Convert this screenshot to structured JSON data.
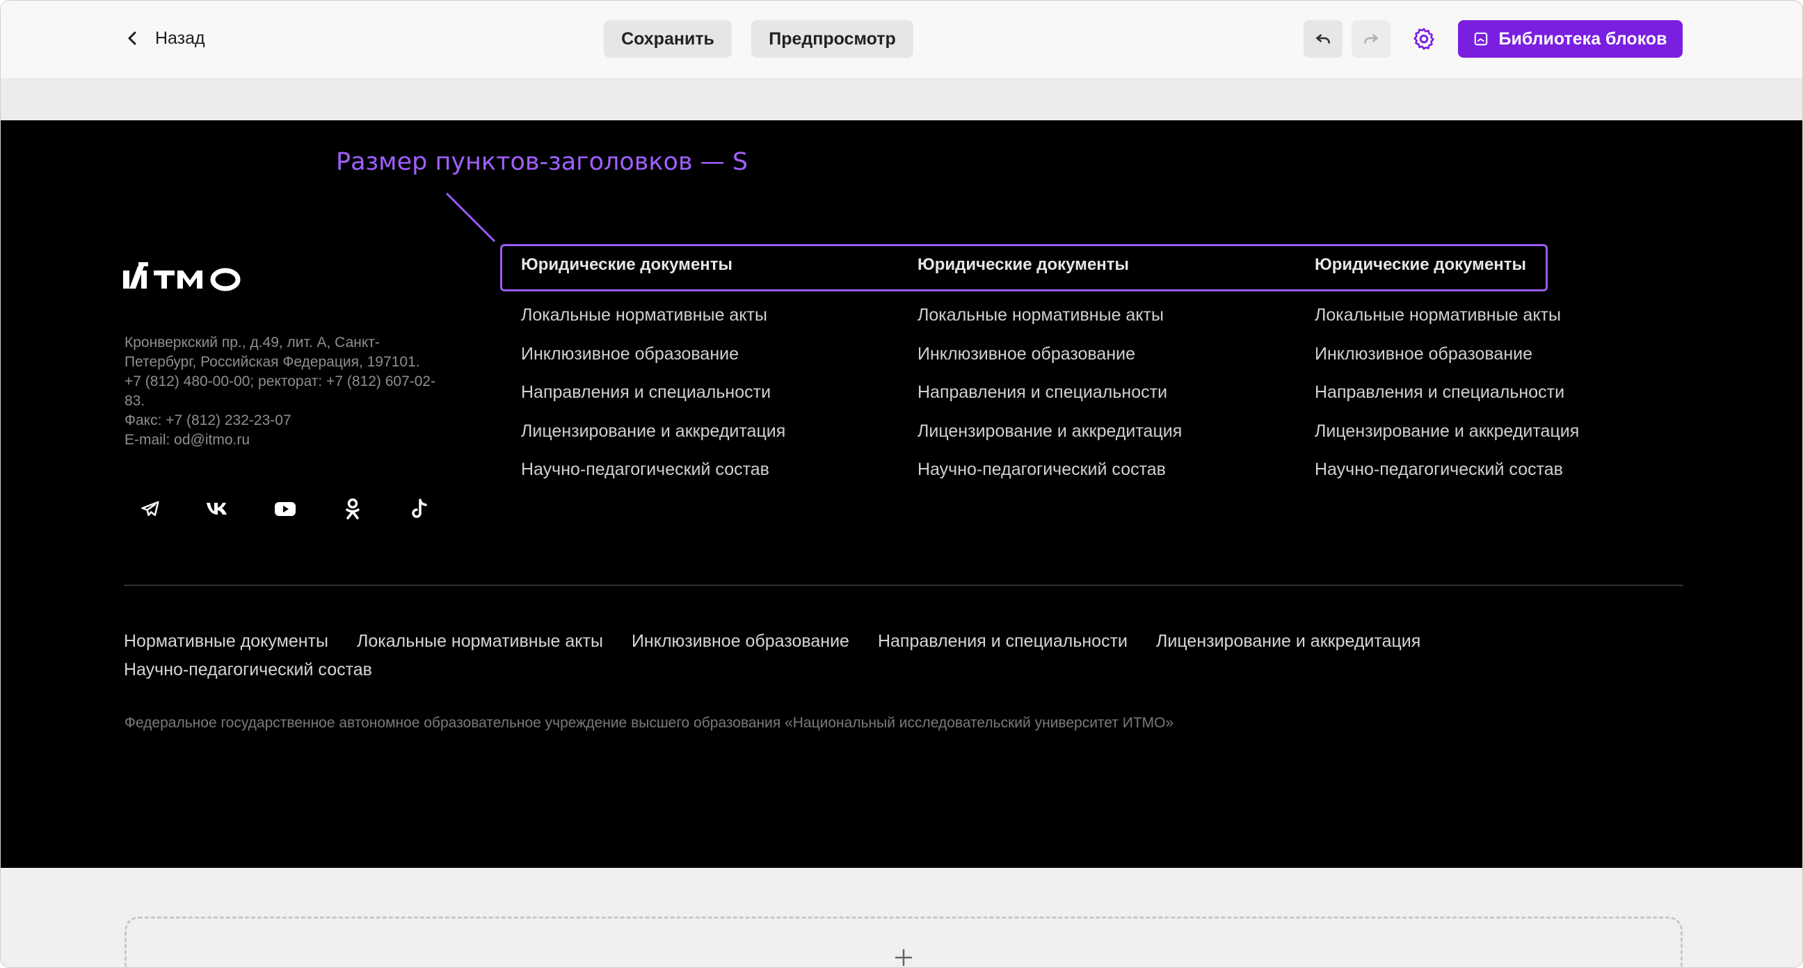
{
  "toolbar": {
    "back_label": "Назад",
    "save_label": "Сохранить",
    "preview_label": "Предпросмотр",
    "library_label": "Библиотека блоков",
    "accent_color": "#7a1fe0"
  },
  "footer": {
    "annotation": "Размер пунктов-заголовков — S",
    "logo_text": "ИТМО",
    "address_lines": [
      "Кронверкский пр., д.49, лит. А, Санкт-",
      "Петербург, Российская Федерация, 197101.",
      "+7 (812) 480-00-00; ректорат: +7 (812) 607-02-",
      "83.",
      "Факс: +7 (812) 232-23-07",
      "E-mail: od@itmo.ru"
    ],
    "social_icons": [
      "telegram-icon",
      "vk-icon",
      "youtube-icon",
      "odnoklassniki-icon",
      "tiktok-icon"
    ],
    "columns": [
      {
        "title": "Юридические документы",
        "links": [
          "Локальные нормативные акты",
          "Инклюзивное образование",
          "Направления и специальности",
          "Лицензирование и аккредитация",
          "Научно-педагогический состав"
        ]
      },
      {
        "title": "Юридические документы",
        "links": [
          "Локальные нормативные акты",
          "Инклюзивное образование",
          "Направления и специальности",
          "Лицензирование и аккредитация",
          "Научно-педагогический состав"
        ]
      },
      {
        "title": "Юридические документы",
        "links": [
          "Локальные нормативные акты",
          "Инклюзивное образование",
          "Направления и специальности",
          "Лицензирование и аккредитация",
          "Научно-педагогический состав"
        ]
      }
    ],
    "bottom_links": [
      "Нормативные документы",
      "Локальные нормативные акты",
      "Инклюзивное образование",
      "Направления и специальности",
      "Лицензирование и аккредитация",
      "Научно-педагогический состав"
    ],
    "legal": "Федеральное государственное автономное образовательное учреждение высшего образования «Национальный исследовательский университет ИТМО»"
  },
  "add_block": {
    "icon": "plus-icon"
  }
}
